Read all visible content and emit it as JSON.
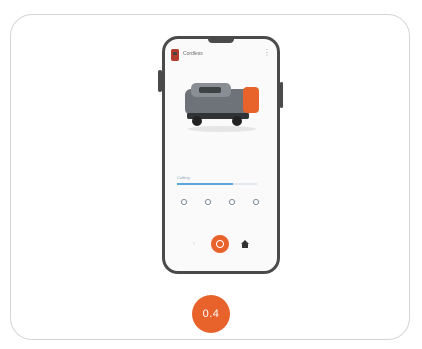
{
  "phone": {
    "device_name": "Cordless",
    "menu_icon": "more-icon",
    "progress_label": "Cutting",
    "progress": 0.7,
    "status_icons": [
      "mode-icon",
      "pin-icon",
      "settings-icon",
      "signal-icon"
    ],
    "mid_text": "···",
    "nav": {
      "left_icon": "back-icon",
      "center_icon": "start-icon",
      "right_icon": "home-icon"
    }
  },
  "step": {
    "label": "0.4"
  },
  "colors": {
    "accent": "#e8632c",
    "progress": "#5aa7e0",
    "frame": "#4a4a4a"
  }
}
